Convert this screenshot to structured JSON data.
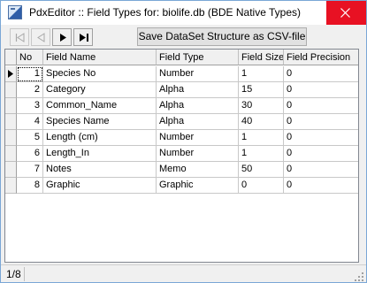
{
  "window": {
    "title": "PdxEditor :: Field Types for: biolife.db (BDE Native Types)",
    "icon": "pdxeditor-app-icon",
    "close_icon": "close-icon",
    "accent": "#e81123"
  },
  "toolbar": {
    "buttons": [
      "first-record-icon",
      "prior-record-icon",
      "next-record-icon",
      "last-record-icon"
    ],
    "save_csv_label": "Save DataSet Structure as CSV-file"
  },
  "grid": {
    "columns": [
      "No",
      "Field Name",
      "Field Type",
      "Field Size",
      "Field Precision"
    ],
    "current_row": 0,
    "rows": [
      {
        "no": "1",
        "name": "Species No",
        "type": "Number",
        "size": "1",
        "precision": "0"
      },
      {
        "no": "2",
        "name": "Category",
        "type": "Alpha",
        "size": "15",
        "precision": "0"
      },
      {
        "no": "3",
        "name": "Common_Name",
        "type": "Alpha",
        "size": "30",
        "precision": "0"
      },
      {
        "no": "4",
        "name": "Species Name",
        "type": "Alpha",
        "size": "40",
        "precision": "0"
      },
      {
        "no": "5",
        "name": "Length (cm)",
        "type": "Number",
        "size": "1",
        "precision": "0"
      },
      {
        "no": "6",
        "name": "Length_In",
        "type": "Number",
        "size": "1",
        "precision": "0"
      },
      {
        "no": "7",
        "name": "Notes",
        "type": "Memo",
        "size": "50",
        "precision": "0"
      },
      {
        "no": "8",
        "name": "Graphic",
        "type": "Graphic",
        "size": "0",
        "precision": "0"
      }
    ]
  },
  "status": {
    "record_position": "1/8"
  }
}
